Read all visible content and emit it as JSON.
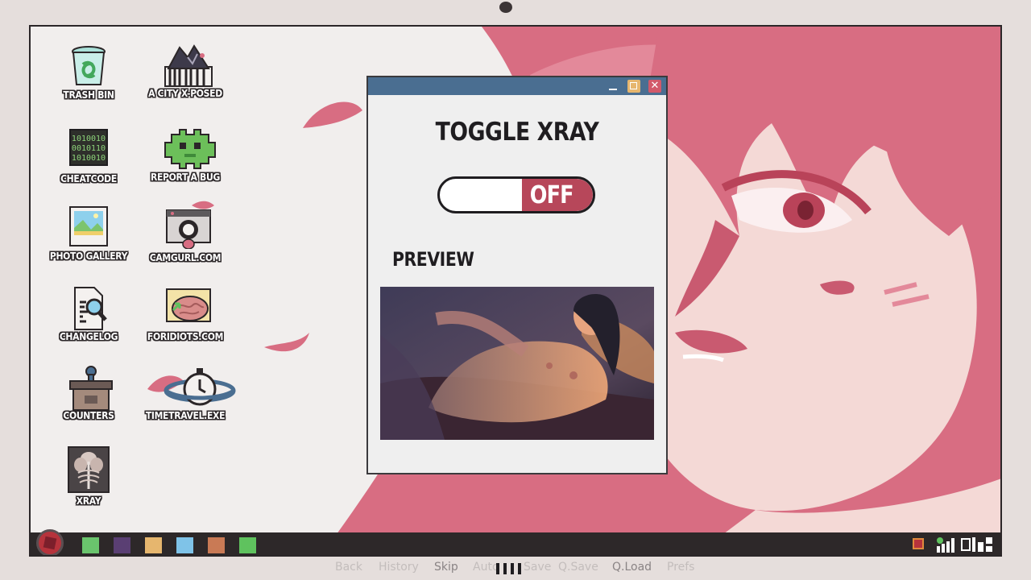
{
  "desktop": {
    "icons": [
      {
        "label": "TRASH BIN",
        "icon": "trash-bin-icon"
      },
      {
        "label": "A CITY X-POSED",
        "icon": "city-app-icon"
      },
      {
        "label": "CHEATCODE",
        "icon": "binary-code-icon"
      },
      {
        "label": "REPORT A BUG",
        "icon": "bug-icon"
      },
      {
        "label": "PHOTO GALLERY",
        "icon": "photo-icon"
      },
      {
        "label": "CAMGURL.COM",
        "icon": "camera-icon"
      },
      {
        "label": "CHANGELOG",
        "icon": "document-search-icon"
      },
      {
        "label": "FORIDIOTS.COM",
        "icon": "brain-icon"
      },
      {
        "label": "COUNTERS",
        "icon": "desk-counter-icon"
      },
      {
        "label": "TIMETRAVEL.EXE",
        "icon": "stopwatch-planet-icon"
      },
      {
        "label": "XRAY",
        "icon": "xray-icon"
      }
    ]
  },
  "window": {
    "title": "TOGGLE XRAY",
    "toggle_state": "OFF",
    "preview_label": "PREVIEW",
    "buttons": [
      "minimize-icon",
      "maximize-icon",
      "close-icon"
    ],
    "titlebar_color": "#4a6e91"
  },
  "taskbar": {
    "colors": [
      "#6ac46d",
      "#5a3f73",
      "#e6b66e",
      "#7fc3e8",
      "#c97a55",
      "#5fc25e"
    ],
    "tray": [
      "stop-icon",
      "signal-icon",
      "window-layout-icon"
    ]
  },
  "quick_menu": {
    "items": [
      "Back",
      "History",
      "Skip",
      "Auto",
      "Save",
      "Q.Save",
      "Q.Load",
      "Prefs"
    ]
  },
  "colors": {
    "wallpaper_pink": "#d86d82",
    "toggle_off": "#b7475a",
    "frame": "#e5dedc"
  }
}
